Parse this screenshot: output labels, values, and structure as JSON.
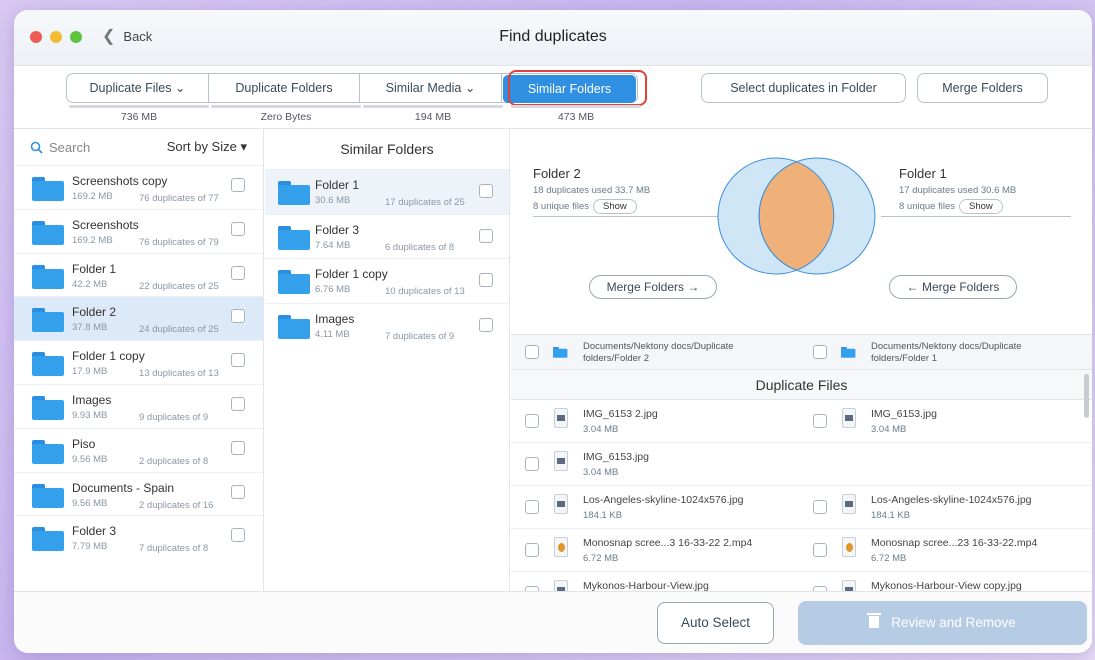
{
  "window": {
    "title": "Find duplicates",
    "back_label": "Back",
    "traffic_lights": [
      "#ee5b52",
      "#f5bd33",
      "#5fc43f"
    ]
  },
  "toolbar": {
    "tabs": [
      {
        "label": "Duplicate Files ⌄",
        "size": "736 MB",
        "active": false
      },
      {
        "label": "Duplicate Folders",
        "size": "Zero Bytes",
        "active": false
      },
      {
        "label": "Similar Media ⌄",
        "size": "194 MB",
        "active": false
      },
      {
        "label": "Similar Folders",
        "size": "473 MB",
        "active": true
      }
    ],
    "select_in_folder": "Select duplicates in Folder",
    "merge_folders": "Merge Folders",
    "accent": "#2f8fe0",
    "highlight": "#e0413b"
  },
  "left": {
    "search_placeholder": "Search",
    "sort_label": "Sort by Size ▾",
    "items": [
      {
        "name": "Screenshots copy",
        "size": "169.2 MB",
        "dups": "76 duplicates of 77"
      },
      {
        "name": "Screenshots",
        "size": "169.2 MB",
        "dups": "76 duplicates of 79"
      },
      {
        "name": "Folder 1",
        "size": "42.2 MB",
        "dups": "22 duplicates of 25"
      },
      {
        "name": "Folder 2",
        "size": "37.8 MB",
        "dups": "24 duplicates of 25",
        "selected": true
      },
      {
        "name": "Folder 1 copy",
        "size": "17.9 MB",
        "dups": "13 duplicates of 13"
      },
      {
        "name": "Images",
        "size": "9.93 MB",
        "dups": "9 duplicates of 9"
      },
      {
        "name": "Piso",
        "size": "9.56 MB",
        "dups": "2 duplicates of 8"
      },
      {
        "name": "Documents - Spain",
        "size": "9.56 MB",
        "dups": "2 duplicates of 16"
      },
      {
        "name": "Folder 3",
        "size": "7.79 MB",
        "dups": "7 duplicates of 8"
      }
    ]
  },
  "middle": {
    "title": "Similar Folders",
    "items": [
      {
        "name": "Folder 1",
        "size": "30.6 MB",
        "dups": "17 duplicates of 25"
      },
      {
        "name": "Folder 3",
        "size": "7.64 MB",
        "dups": "6 duplicates of 8"
      },
      {
        "name": "Folder 1 copy",
        "size": "6.76 MB",
        "dups": "10 duplicates of 13"
      },
      {
        "name": "Images",
        "size": "4.11 MB",
        "dups": "7 duplicates of 9"
      }
    ]
  },
  "compare": {
    "left": {
      "title": "Folder 2",
      "used": "18 duplicates used 33.7 MB",
      "unique": "8 unique files",
      "show": "Show"
    },
    "right": {
      "title": "Folder 1",
      "used": "17 duplicates used 30.6 MB",
      "unique": "8 unique files",
      "show": "Show"
    },
    "merge_right": "Merge Folders →",
    "merge_left": "← Merge Folders",
    "path_left": "Documents/Nektony docs/Duplicate folders/Folder 2",
    "path_right": "Documents/Nektony docs/Duplicate folders/Folder 1"
  },
  "files": {
    "title": "Duplicate Files",
    "rows": [
      {
        "left": {
          "name": "IMG_6153 2.jpg",
          "size": "3.04 MB",
          "type": "image"
        },
        "right": {
          "name": "IMG_6153.jpg",
          "size": "3.04 MB",
          "type": "image"
        }
      },
      {
        "left": {
          "name": "IMG_6153.jpg",
          "size": "3.04 MB",
          "type": "image"
        },
        "right": null
      },
      {
        "left": {
          "name": "Los-Angeles-skyline-1024x576.jpg",
          "size": "184.1 KB",
          "type": "image"
        },
        "right": {
          "name": "Los-Angeles-skyline-1024x576.jpg",
          "size": "184.1 KB",
          "type": "image"
        }
      },
      {
        "left": {
          "name": "Monosnap scree...3 16-33-22 2.mp4",
          "size": "6.72 MB",
          "type": "video"
        },
        "right": {
          "name": "Monosnap scree...23 16-33-22.mp4",
          "size": "6.72 MB",
          "type": "video"
        }
      },
      {
        "left": {
          "name": "Mykonos-Harbour-View.jpg",
          "size": "",
          "type": "image"
        },
        "right": {
          "name": "Mykonos-Harbour-View copy.jpg",
          "size": "",
          "type": "image"
        }
      }
    ]
  },
  "footer": {
    "auto_select": "Auto Select",
    "review_remove": "Review and Remove"
  }
}
